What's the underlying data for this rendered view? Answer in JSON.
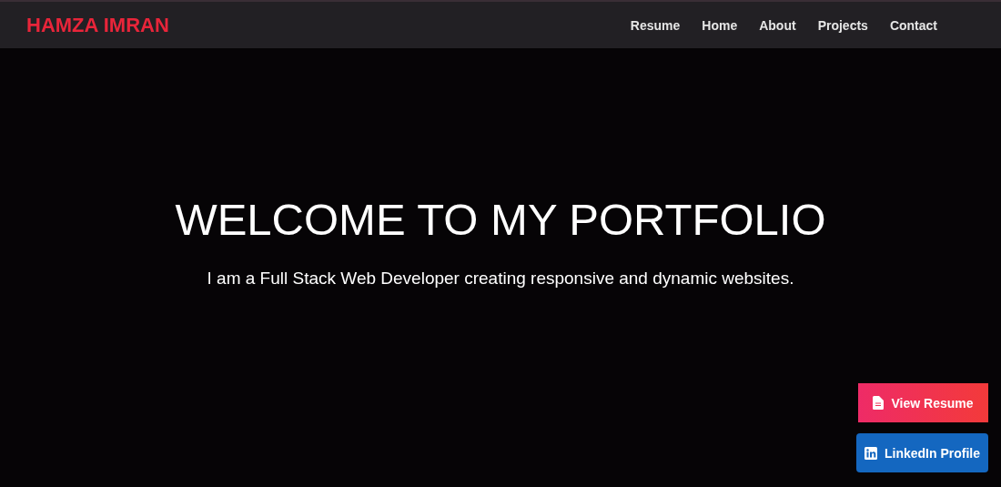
{
  "brand": "HAMZA IMRAN",
  "nav": [
    {
      "label": "Resume"
    },
    {
      "label": "Home"
    },
    {
      "label": "About"
    },
    {
      "label": "Projects"
    },
    {
      "label": "Contact"
    }
  ],
  "hero": {
    "title": "WELCOME TO MY PORTFOLIO",
    "subtitle": "I am a Full Stack Web Developer creating responsive and dynamic websites."
  },
  "floating_buttons": [
    {
      "kind": "resume",
      "label": "View Resume"
    },
    {
      "kind": "linkedin",
      "label": "LinkedIn Profile"
    }
  ]
}
